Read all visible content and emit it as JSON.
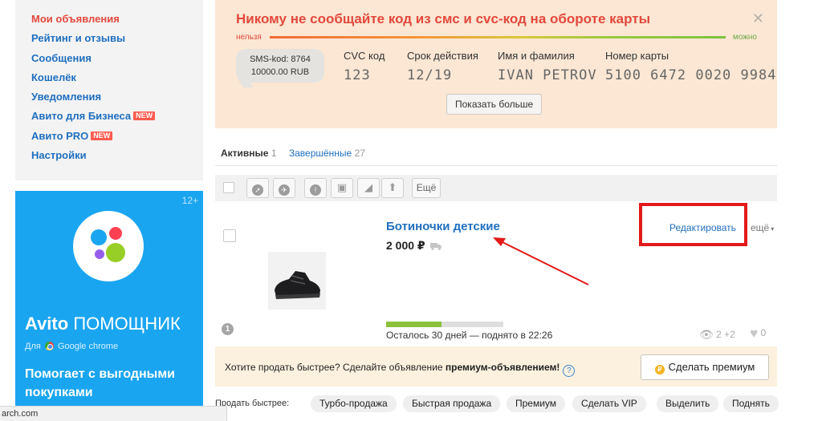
{
  "sidebar": {
    "items": [
      {
        "label": "Мои объявления",
        "active": true
      },
      {
        "label": "Рейтинг и отзывы"
      },
      {
        "label": "Сообщения"
      },
      {
        "label": "Кошелёк"
      },
      {
        "label": "Уведомления"
      },
      {
        "label": "Авито для Бизнеса",
        "badge": "NEW"
      },
      {
        "label": "Авито PRO",
        "badge": "NEW"
      },
      {
        "label": "Настройки"
      }
    ]
  },
  "ad": {
    "age": "12+",
    "brand": "Avito",
    "brand_rest": "ПОМОЩНИК",
    "for_prefix": "Для",
    "browser": "Google chrome",
    "slogan": "Помогает с выгодными покупками",
    "colors": {
      "bg": "#1aa5f0"
    }
  },
  "warning": {
    "headline": "Никому не сообщайте код из смс и cvc-код на обороте карты",
    "label_no": "нельзя",
    "label_ok": "можно",
    "sms_line1": "SMS-kod: 8764",
    "sms_line2": "10000.00 RUB",
    "fields": {
      "cvc_label": "CVC код",
      "cvc_value": "123",
      "exp_label": "Срок действия",
      "exp_value": "12/19",
      "name_label": "Имя и фамилия",
      "name_value": "IVAN PETROV",
      "card_label": "Номер карты",
      "card_value": "5100 6472 0020 9984"
    },
    "more_button": "Показать больше",
    "close_icon": "close-icon"
  },
  "tabs": {
    "active_label": "Активные",
    "active_count": "1",
    "done_label": "Завершённые",
    "done_count": "27"
  },
  "toolbar": {
    "more_label": "Ещё",
    "icons": [
      "checkbox",
      "compass-icon",
      "plane-icon",
      "info-icon",
      "delete-icon",
      "eraser-icon",
      "arrow-up-icon"
    ]
  },
  "listing": {
    "title": "Ботиночки детские",
    "price": "2 000 ₽",
    "edit_label": "Редактировать",
    "more_label": "ещё",
    "remaining": "Осталось 30 дней — поднято в 22:26",
    "progress_fraction": 0.47,
    "views": "2 +2",
    "favorites": "0",
    "info_badge": "1"
  },
  "premium": {
    "text_before": "Хотите продать быстрее? Сделайте объявление ",
    "text_bold": "премиум-объявлением!",
    "help": "?",
    "button": "Сделать премиум"
  },
  "quick": {
    "label": "Продать быстрее:",
    "chips": [
      "Турбо-продажа",
      "Быстрая продажа",
      "Премиум",
      "Сделать VIP",
      "Выделить",
      "Поднять"
    ]
  },
  "statusbar": {
    "text": "arch.com"
  },
  "colors": {
    "link": "#1f6fbf",
    "accent_red": "#e3483d",
    "highlight_box": "#e31a1a",
    "progress_green": "#8cc23c"
  }
}
